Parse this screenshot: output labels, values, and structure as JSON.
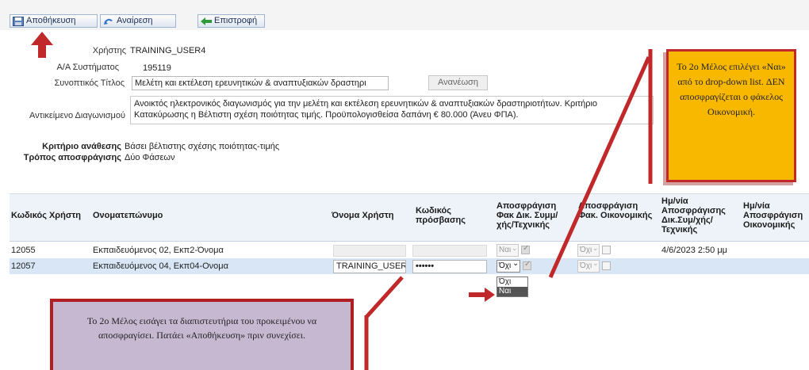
{
  "toolbar": {
    "save_label": "Αποθήκευση",
    "undo_label": "Αναίρεση",
    "back_label": "Επιστροφή"
  },
  "form": {
    "user_label": "Χρήστης",
    "user_value": "TRAINING_USER4",
    "sys_no_label": "Α/Α Συστήματος",
    "sys_no_value": "195119",
    "short_title_label": "Συνοπτικός Τίτλος",
    "short_title_value": "Μελέτη και εκτέλεση ερευνητικών & αναπτυξιακών δραστηρι",
    "refresh_label": "Ανανέωση",
    "subject_label": "Αντικείμενο Διαγωνισμού",
    "subject_value": "Ανοικτός ηλεκτρονικός διαγωνισμός για την  μελέτη και εκτέλεση ερευνητικών & αναπτυξιακών δραστηριοτήτων. Κριτήριο Κατακύρωσης η Βέλτιστη σχέση ποιότητας τιμής. Προϋπολογισθείσα δαπάνη € 80.000 (Άνευ ΦΠΑ).",
    "award_label": "Κριτήριο ανάθεσης",
    "award_value": "Βάσει βέλτιστης σχέσης ποιότητας-τιμής",
    "unseal_label": "Τρόπος αποσφράγισης",
    "unseal_value": "Δύο Φάσεων"
  },
  "table": {
    "headers": {
      "code": "Κωδικός Χρήστη",
      "name": "Ονοματεπώνυμο",
      "username": "Όνομα Χρήστη",
      "password": "Κωδικός πρόσβασης",
      "tech": "Αποσφράγιση Φακ Δικ. Συμμ/ χής/Τεχνικής",
      "fin": "Αποσφράγιση Φακ. Οικονομικής",
      "tech_date": "Ημ/νία Αποσφράγισης Δικ.Συμ/χής/ Τεχνικής",
      "fin_date": "Ημ/νία Αποσφράγιση Οικονομικής"
    },
    "rows": [
      {
        "code": "12055",
        "name": "Εκπαιδευόμενος 02, Εκπ2-Όνομα",
        "username": "",
        "password": "",
        "tech_select": "Ναι",
        "fin_select": "Όχι",
        "tech_date": "4/6/2023 2:50 μμ",
        "fin_date": ""
      },
      {
        "code": "12057",
        "name": "Εκπαιδευόμενος 04, Εκπ04-Ονομα",
        "username": "TRAINING_USER",
        "password": "••••••",
        "tech_select": "Όχι",
        "fin_select": "Όχι",
        "tech_date": "",
        "fin_date": ""
      }
    ],
    "dropdown_options": [
      "Όχι",
      "Ναι"
    ]
  },
  "callouts": {
    "yellow_text": "Το 2ο Μέλος επιλέγει «Ναι» από το drop-down list. ΔΕΝ αποσφραγίζεται ο φάκελος Οικονομική.",
    "purple_text": "Το 2ο Μέλος εισάγει τα διαπιστευτήρια του προκειμένου να αποσφραγίσει. Πατάει «Αποθήκευση» πριν συνεχίσει."
  },
  "colors": {
    "accent_red": "#c0282a",
    "callout_yellow": "#f9b800",
    "callout_purple": "#c6b8d1",
    "selected_row": "#d9e6f5"
  }
}
